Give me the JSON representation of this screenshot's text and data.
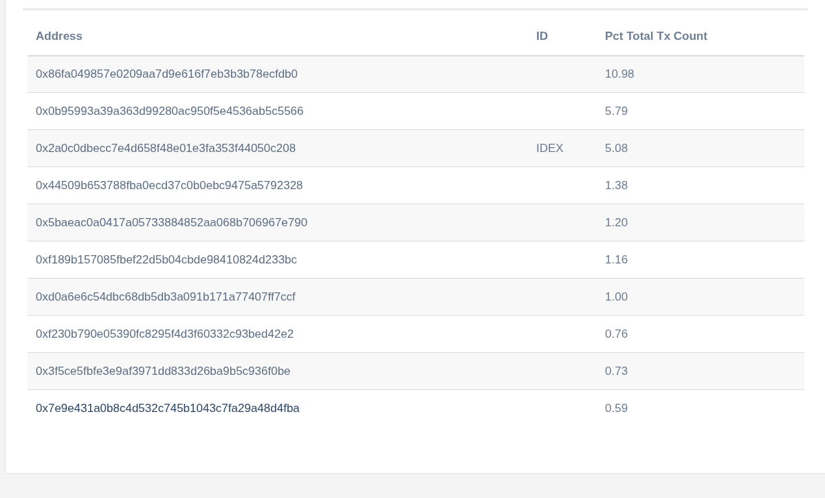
{
  "table": {
    "columns": [
      "Address",
      "ID",
      "Pct Total Tx Count"
    ],
    "rows": [
      {
        "address": "0x86fa049857e0209aa7d9e616f7eb3b3b78ecfdb0",
        "id": "",
        "pct": "10.98",
        "hovered": false
      },
      {
        "address": "0x0b95993a39a363d99280ac950f5e4536ab5c5566",
        "id": "",
        "pct": "5.79",
        "hovered": false
      },
      {
        "address": "0x2a0c0dbecc7e4d658f48e01e3fa353f44050c208",
        "id": "IDEX",
        "pct": "5.08",
        "hovered": false
      },
      {
        "address": "0x44509b653788fba0ecd37c0b0ebc9475a5792328",
        "id": "",
        "pct": "1.38",
        "hovered": false
      },
      {
        "address": "0x5baeac0a0417a05733884852aa068b706967e790",
        "id": "",
        "pct": "1.20",
        "hovered": false
      },
      {
        "address": "0xf189b157085fbef22d5b04cbde98410824d233bc",
        "id": "",
        "pct": "1.16",
        "hovered": false
      },
      {
        "address": "0xd0a6e6c54dbc68db5db3a091b171a77407ff7ccf",
        "id": "",
        "pct": "1.00",
        "hovered": false
      },
      {
        "address": "0xf230b790e05390fc8295f4d3f60332c93bed42e2",
        "id": "",
        "pct": "0.76",
        "hovered": false
      },
      {
        "address": "0x3f5ce5fbfe3e9af3971dd833d26ba9b5c936f0be",
        "id": "",
        "pct": "0.73",
        "hovered": false
      },
      {
        "address": "0x7e9e431a0b8c4d532c745b1043c7fa29a48d4fba",
        "id": "",
        "pct": "0.59",
        "hovered": true
      }
    ]
  }
}
